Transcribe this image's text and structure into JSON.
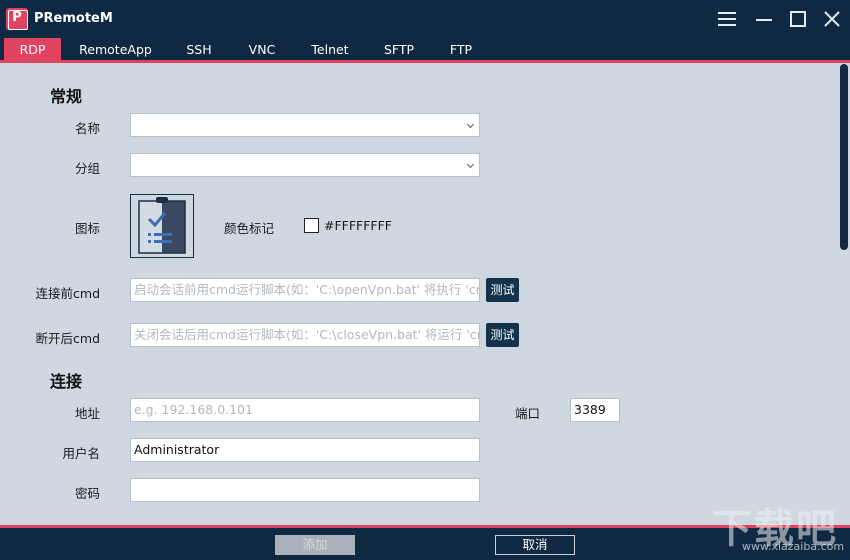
{
  "app": {
    "title": "PRemoteM",
    "logo_letter": "P"
  },
  "tabs": [
    {
      "label": "RDP",
      "active": true
    },
    {
      "label": "RemoteApp"
    },
    {
      "label": "SSH"
    },
    {
      "label": "VNC"
    },
    {
      "label": "Telnet"
    },
    {
      "label": "SFTP"
    },
    {
      "label": "FTP"
    }
  ],
  "general": {
    "title": "常规",
    "name_label": "名称",
    "name_value": "",
    "group_label": "分组",
    "group_value": "",
    "icon_label": "图标",
    "color_label": "颜色标记",
    "color_value": "#FFFFFFFF",
    "pre_cmd_label": "连接前cmd",
    "pre_cmd_placeholder": "启动会话前用cmd运行脚本(如：'C:\\openVpn.bat' 将执行 'cmd.",
    "post_cmd_label": "断开后cmd",
    "post_cmd_placeholder": "关闭会话后用cmd运行脚本(如：'C:\\closeVpn.bat' 将运行 'cmd.",
    "test_label": "测试"
  },
  "connection": {
    "title": "连接",
    "address_label": "地址",
    "address_placeholder": "e.g. 192.168.0.101",
    "port_label": "端口",
    "port_value": "3389",
    "username_label": "用户名",
    "username_value": "Administrator",
    "password_label": "密码",
    "password_value": ""
  },
  "footer": {
    "add_label": "添加",
    "cancel_label": "取消"
  },
  "watermark": {
    "main": "下载吧",
    "sub": "www.xiazaiba.com"
  },
  "colors": {
    "accent": "#e0435f",
    "navy": "#0f2942",
    "panel": "#cfd8e1"
  }
}
